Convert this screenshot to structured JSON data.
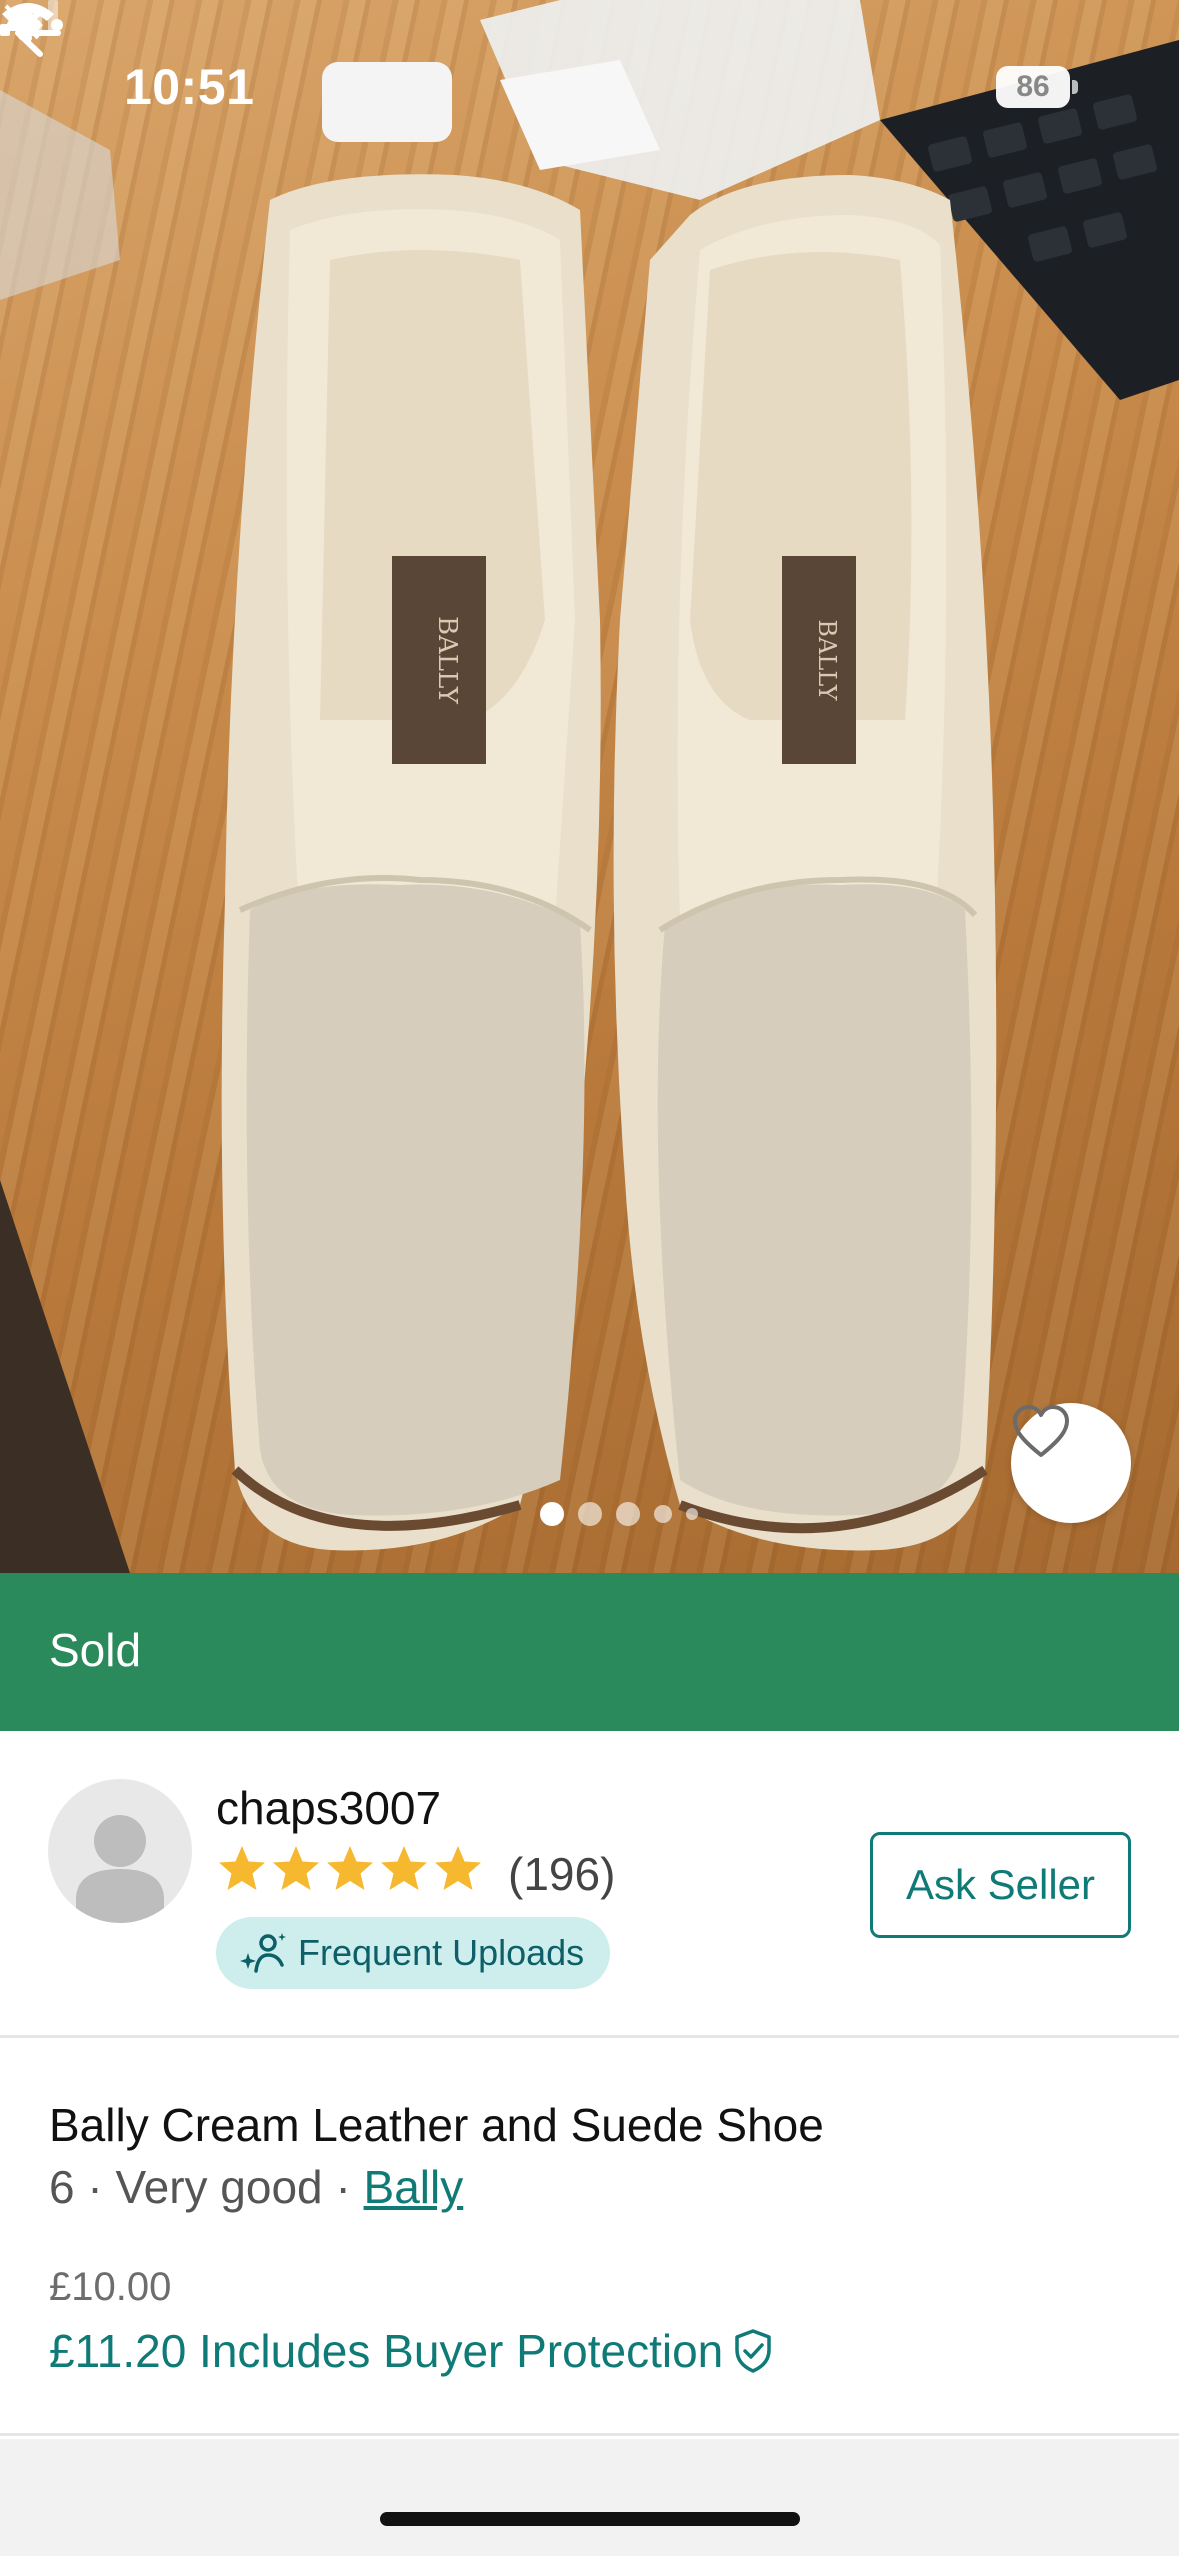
{
  "status_bar": {
    "time": "10:51",
    "battery": "86"
  },
  "photo": {
    "total_images": 5,
    "active_index": 0
  },
  "banner": {
    "status": "Sold",
    "color": "#2a8a5c"
  },
  "seller": {
    "username": "chaps3007",
    "rating": 5,
    "review_count": "(196)",
    "badge": "Frequent Uploads",
    "ask_label": "Ask Seller"
  },
  "item": {
    "title": "Bally Cream Leather and Suede Shoe",
    "size": "6",
    "condition": "Very good",
    "brand": "Bally",
    "price": "£10.00",
    "total_price": "£11.20 Includes Buyer Protection"
  },
  "icons": [
    "back-arrow-icon",
    "more-icon",
    "heart-icon",
    "shield-check-icon",
    "sparkle-user-icon",
    "bell-slash-icon"
  ],
  "colors": {
    "accent": "#0f7a76",
    "star": "#f5b82e",
    "badge_bg": "#cdeeed"
  }
}
